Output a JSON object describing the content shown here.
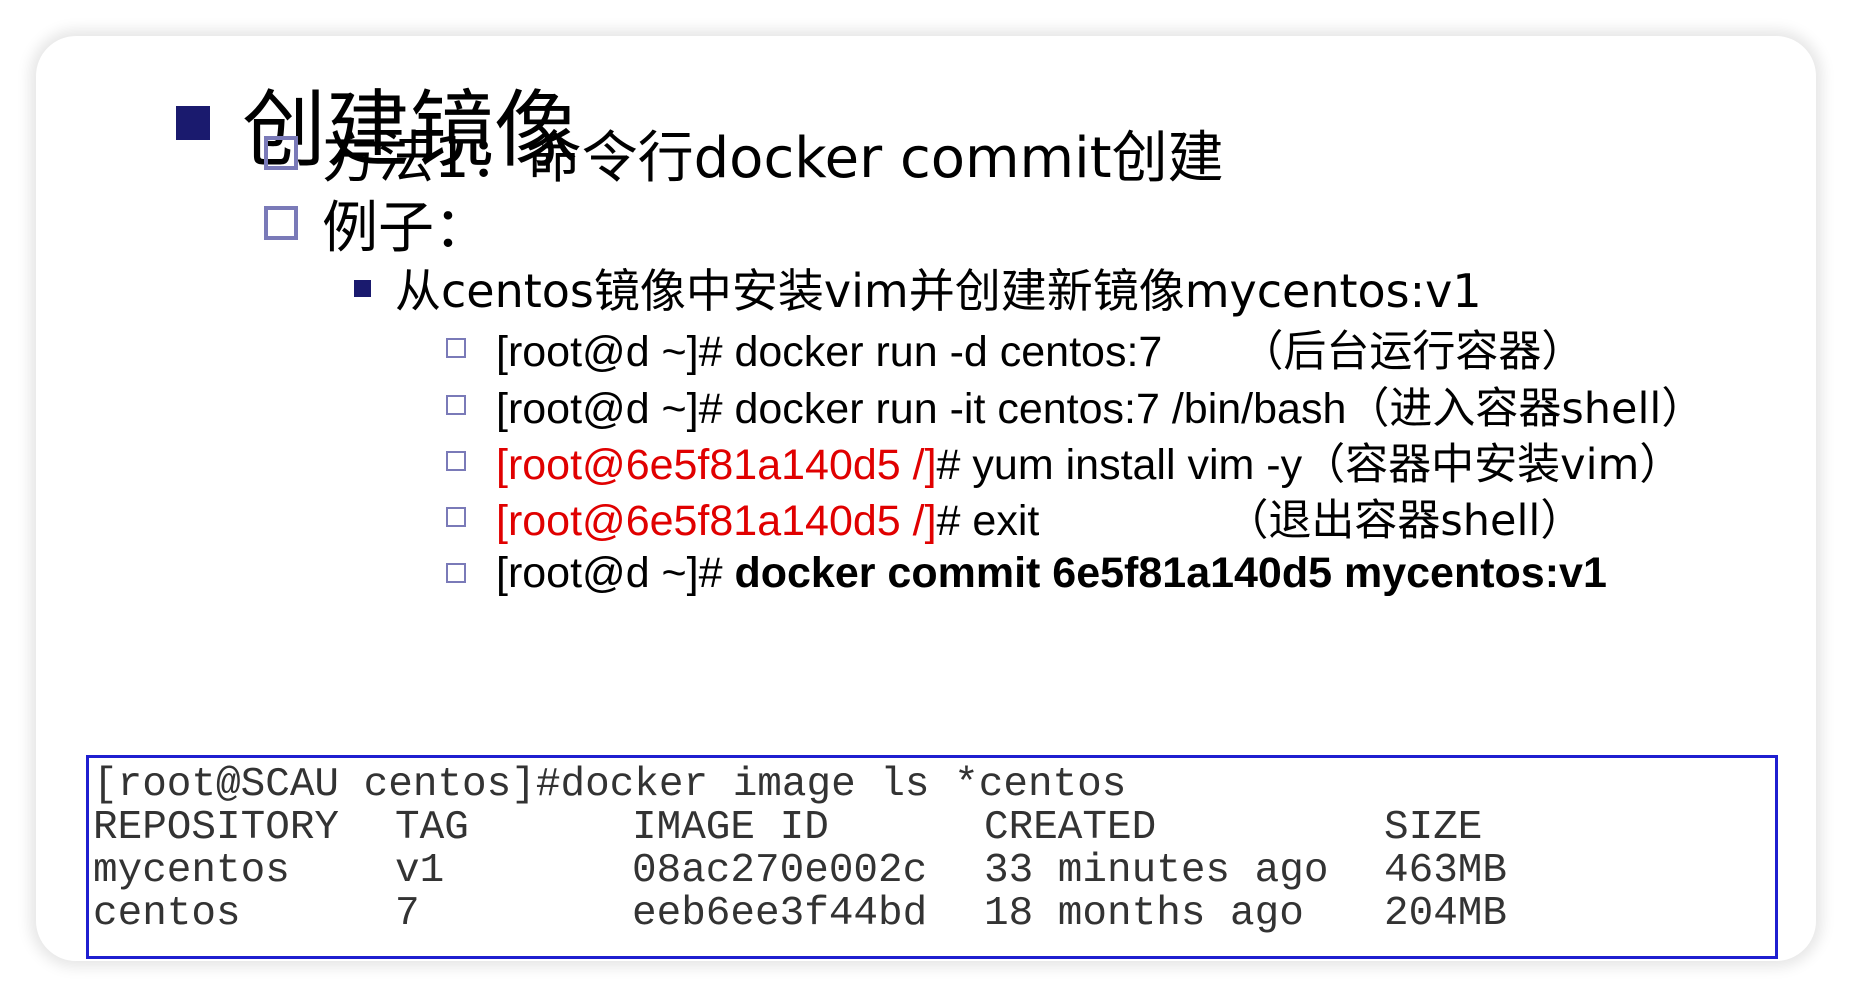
{
  "heading": "创建镜像",
  "method": "方法1：命令行docker commit创建",
  "example": "例子：",
  "sub_item": "从centos镜像中安装vim并创建新镜像mycentos:v1",
  "commands": [
    {
      "prompt": "[root@d ~]#",
      "cmd": " docker run -d centos:7",
      "note": "（后台运行容器）"
    },
    {
      "prompt": "[root@d ~]#",
      "cmd": " docker run -it centos:7 /bin/bash",
      "note": "（进入容器shell）"
    },
    {
      "prompt": "[root@6e5f81a140d5 /]",
      "suffix": "#",
      "cmd": " yum install vim -y",
      "note": "（容器中安装vim）"
    },
    {
      "prompt": "[root@6e5f81a140d5 /]",
      "suffix": "#",
      "cmd": " exit",
      "note": "（退出容器shell）"
    },
    {
      "prompt": "[root@d ~]#",
      "cmd": " docker commit 6e5f81a140d5 mycentos:v1",
      "note": ""
    }
  ],
  "terminal": {
    "command_line": "[root@SCAU centos]#docker image ls *centos",
    "headers": [
      "REPOSITORY",
      "TAG",
      "IMAGE ID",
      "CREATED",
      "SIZE"
    ],
    "rows": [
      [
        "mycentos",
        "v1",
        "08ac270e002c",
        "33 minutes ago",
        "463MB"
      ],
      [
        "centos",
        "7",
        "eeb6ee3f44bd",
        "18 months ago",
        "204MB"
      ]
    ]
  },
  "colors": {
    "accent_red": "#e00000",
    "terminal_border": "#1f1fd0",
    "bullet": "#1a1a6e"
  }
}
